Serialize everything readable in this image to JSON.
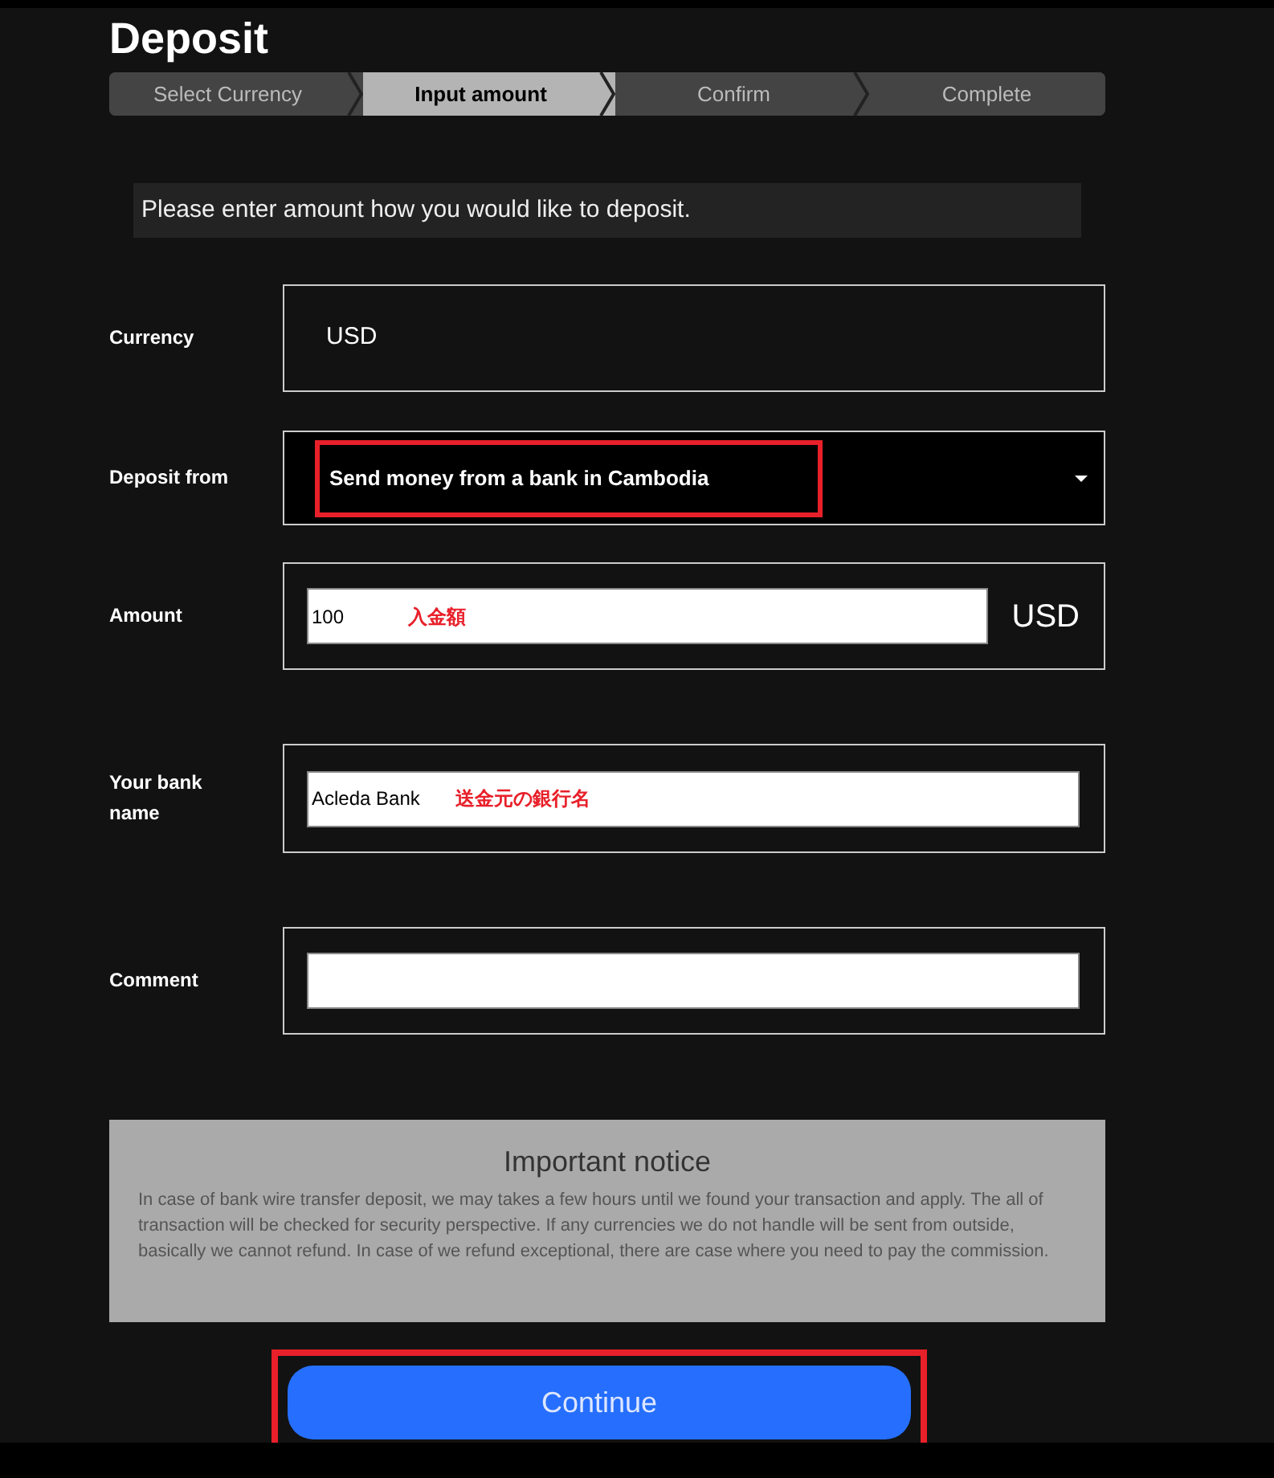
{
  "title": "Deposit",
  "steps": [
    {
      "label": "Select Currency",
      "selected": false
    },
    {
      "label": "Input amount",
      "selected": true
    },
    {
      "label": "Confirm",
      "selected": false
    },
    {
      "label": "Complete",
      "selected": false
    }
  ],
  "instruction": "Please enter amount how you would like to deposit.",
  "fields": [
    {
      "kind": "static",
      "label": "Currency",
      "value": "USD"
    },
    {
      "kind": "select",
      "label": "Deposit from",
      "value": "Send money from a bank in Cambodia",
      "highlighted": true
    },
    {
      "kind": "input",
      "label": "Amount",
      "value": "100",
      "annotation": "入金額",
      "unit": "USD"
    },
    {
      "kind": "input",
      "label": "Your bank name",
      "value": "Acleda Bank",
      "annotation": "送金元の銀行名"
    },
    {
      "kind": "input",
      "label": "Comment"
    }
  ],
  "notice": {
    "title": "Important notice",
    "body": "In case of bank wire transfer deposit, we may takes a few hours until we found your transaction and apply. The all of transaction will be checked for security perspective. If any currencies we do not handle will be sent from outside, basically we cannot refund. In case of we refund exceptional, there are case where you need to pay the commission."
  },
  "continue_button": {
    "label": "Continue",
    "highlighted": true
  }
}
